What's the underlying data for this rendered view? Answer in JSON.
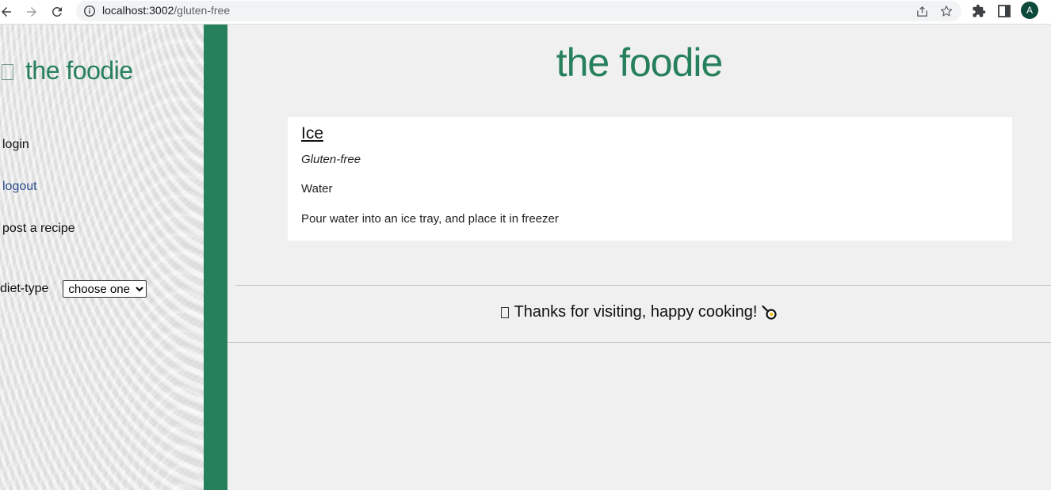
{
  "browser": {
    "url_host": "localhost:3002",
    "url_path": "/gluten-free",
    "profile_initial": "A",
    "icons": [
      "back-icon",
      "forward-icon",
      "reload-icon",
      "info-icon",
      "share-icon",
      "star-icon",
      "extensions-icon",
      "side-panel-icon"
    ]
  },
  "sidebar": {
    "logo_text": "the foodie",
    "links": {
      "login": "login",
      "logout": "logout",
      "post": "post a recipe"
    },
    "diet_label": "diet-type",
    "diet_select_value": "choose one"
  },
  "main": {
    "title": "the foodie",
    "recipe": {
      "name": "Ice",
      "diet": "Gluten-free",
      "ingredients": "Water",
      "instructions": "Pour water into an ice tray, and place it in freezer"
    },
    "footer": {
      "message": "Thanks for visiting, happy cooking!",
      "icon": "frying-pan-egg-icon"
    }
  },
  "colors": {
    "brand_green": "#27805c",
    "logout_link": "#2b4d8c",
    "avatar": "#0b4a3b"
  }
}
